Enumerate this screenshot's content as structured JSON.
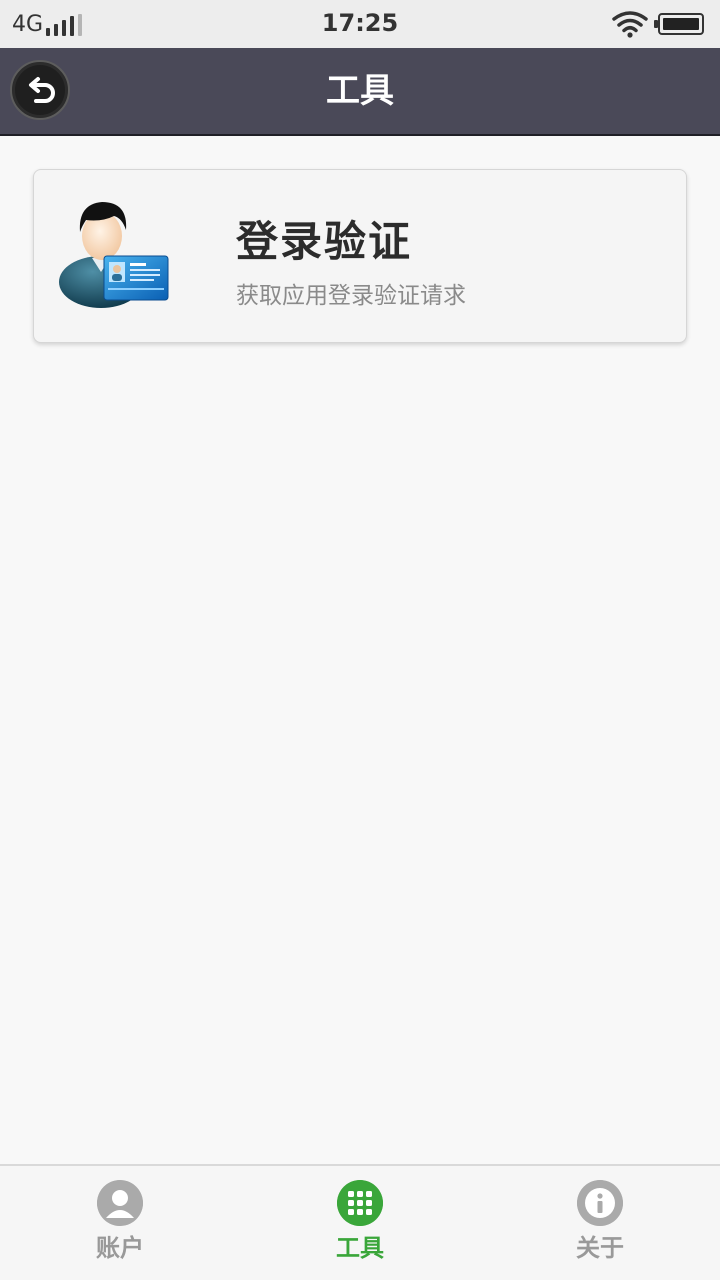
{
  "status_bar": {
    "network": "4G",
    "time": "17:25"
  },
  "header": {
    "title": "工具"
  },
  "tools": [
    {
      "title": "登录验证",
      "description": "获取应用登录验证请求",
      "icon": "user-id-card-icon"
    }
  ],
  "bottom_nav": {
    "items": [
      {
        "label": "账户",
        "icon": "user-icon",
        "active": false
      },
      {
        "label": "工具",
        "icon": "grid-icon",
        "active": true
      },
      {
        "label": "关于",
        "icon": "info-icon",
        "active": false
      }
    ]
  },
  "colors": {
    "header_bg": "#4a4958",
    "active": "#3aa63a",
    "inactive": "#aaaaaa"
  }
}
